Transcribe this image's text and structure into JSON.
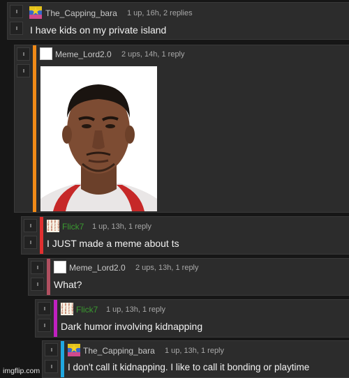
{
  "comments": [
    {
      "username": "The_Capping_bara",
      "meta": "1 up, 16h, 2 replies",
      "text": "I have kids on my private island",
      "bar_color": "",
      "avatar": "star-flag-avatar"
    },
    {
      "username": "Meme_Lord2.0",
      "meta": "2 ups, 14h, 1 reply",
      "text": "",
      "bar_color": "#f08a18",
      "avatar": "blank-avatar",
      "image": "headshot-photo"
    },
    {
      "username": "Flick7",
      "meta": "1 up, 13h, 1 reply",
      "text": "I JUST made a meme about ts",
      "bar_color": "#e03030",
      "avatar": "binary-code-avatar",
      "username_color": "#3a9a30",
      "avatar_text": "1 0 0 1 1\n0 1 1 0 1\n1 0 1 0 1\n0 0 1 1 0"
    },
    {
      "username": "Meme_Lord2.0",
      "meta": "2 ups, 13h, 1 reply",
      "text": "What?",
      "bar_color": "#b05060",
      "avatar": "blank-avatar"
    },
    {
      "username": "Flick7",
      "meta": "1 up, 13h, 1 reply",
      "text": "Dark humor involving kidnapping",
      "bar_color": "#c020c0",
      "avatar": "binary-code-avatar",
      "username_color": "#3a9a30",
      "avatar_text": "1 0 0 1 1\n0 1 1 0 1\n1 0 1 0 1\n0 0 1 1 0"
    },
    {
      "username": "The_Capping_bara",
      "meta": "1 up, 13h, 1 reply",
      "text": "I don't call it kidnapping. I like to call it bonding or playtime",
      "bar_color": "#20a8e0",
      "avatar": "star-flag-avatar"
    }
  ],
  "watermark": "imgflip.com",
  "colors": {
    "page_bg": "#161616",
    "comment_bg": "#2c2c2c"
  }
}
